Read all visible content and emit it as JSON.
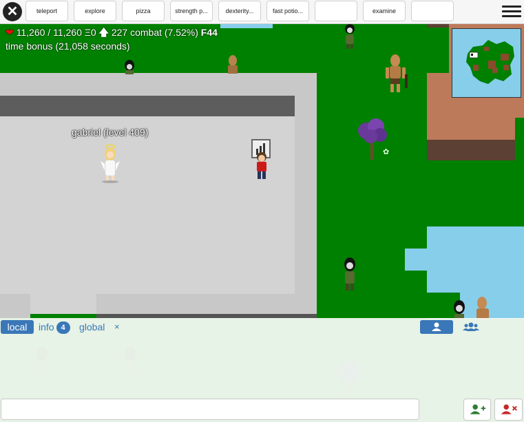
{
  "toolbar": {
    "close_icon": "close-icon",
    "buttons": [
      {
        "label": "teleport"
      },
      {
        "label": "explore"
      },
      {
        "label": "pizza"
      },
      {
        "label": "strength p..."
      },
      {
        "label": "dexterity..."
      },
      {
        "label": "fast potio..."
      },
      {
        "label": ""
      },
      {
        "label": "examine"
      },
      {
        "label": ""
      }
    ],
    "menu_icon": "hamburger-menu-icon"
  },
  "hud": {
    "hp": "11,260 / 11,260",
    "energy": "Ξ0",
    "combat_level": "227",
    "combat_label": "combat (7.52%)",
    "floor": "F44",
    "time_bonus": "time bonus (21,058 seconds)"
  },
  "world": {
    "player_name_label": "gabriel (level 409)",
    "colors": {
      "grass": "#008000",
      "water": "#87ceeb",
      "building_floor": "#d3d3d3",
      "dirt": "#bd7a5b",
      "dirt_dark": "#5c4033"
    }
  },
  "chat": {
    "tabs": {
      "local": "local",
      "info": "info",
      "info_count": "4",
      "global": "global",
      "close": "×"
    },
    "input_value": "",
    "accent": "#3a77b8"
  }
}
